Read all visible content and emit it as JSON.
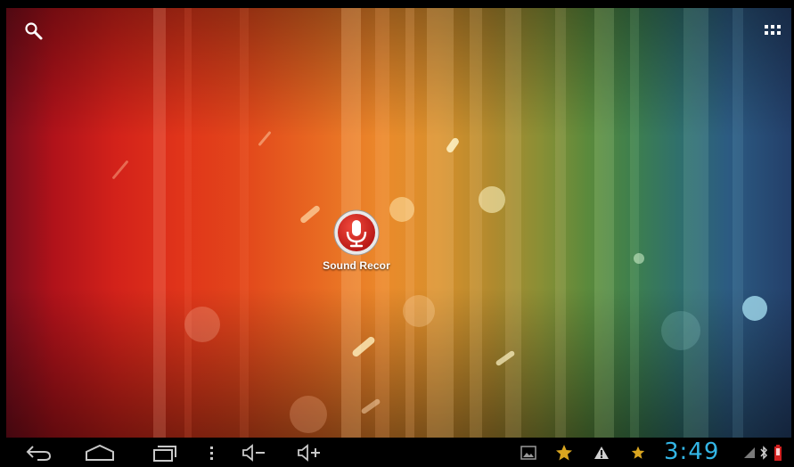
{
  "top_bar": {
    "search_icon": "search-icon",
    "apps_icon": "all-apps-grid-icon"
  },
  "desktop": {
    "shortcuts": [
      {
        "label": "Sound Recor",
        "icon": "microphone-icon"
      }
    ]
  },
  "system_bar": {
    "nav_buttons": [
      {
        "name": "back",
        "icon": "back-arrow-icon"
      },
      {
        "name": "home",
        "icon": "home-icon"
      },
      {
        "name": "recent-apps",
        "icon": "recent-apps-icon"
      },
      {
        "name": "menu",
        "icon": "menu-dots-icon"
      },
      {
        "name": "volume-down",
        "icon": "volume-down-icon"
      },
      {
        "name": "volume-up",
        "icon": "volume-up-icon"
      }
    ],
    "notifications": [
      {
        "name": "screenshot",
        "icon": "image-icon"
      },
      {
        "name": "star-notification",
        "icon": "star-icon"
      },
      {
        "name": "warning",
        "icon": "warning-icon"
      },
      {
        "name": "star-notification-small",
        "icon": "star-icon"
      }
    ],
    "clock": "3:49",
    "status_icons": [
      "signal-icon",
      "bluetooth-icon",
      "battery-low-icon"
    ]
  },
  "colors": {
    "clock": "#33b5e5",
    "navbar": "#000000",
    "notification_star": "#d9a520",
    "battery_low": "#d12020"
  }
}
